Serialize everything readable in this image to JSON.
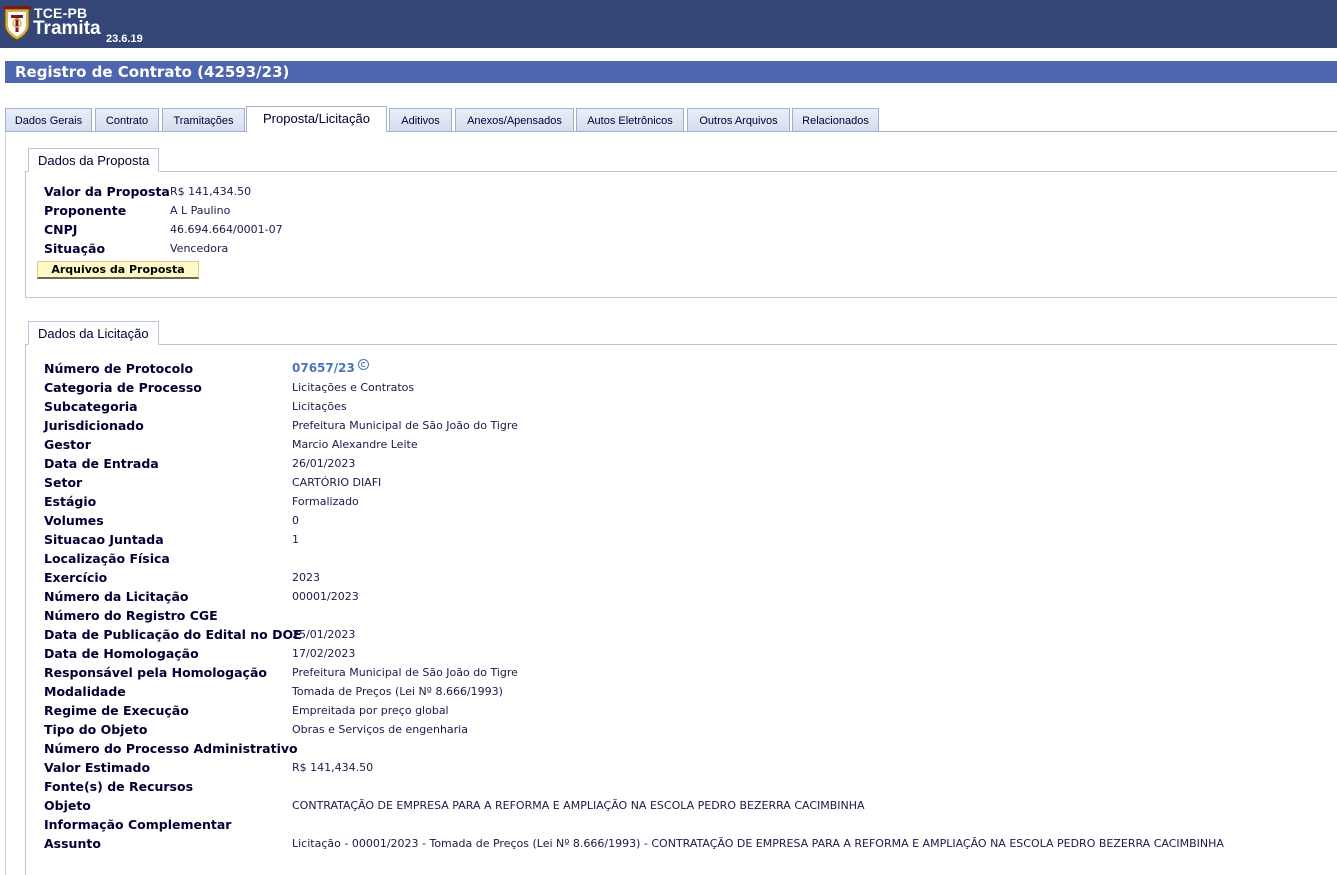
{
  "app": {
    "org": "TCE-PB",
    "name": "Tramita",
    "version": "23.6.19"
  },
  "page": {
    "title": "Registro de Contrato (42593/23)"
  },
  "tabs": [
    {
      "label": "Dados Gerais"
    },
    {
      "label": "Contrato"
    },
    {
      "label": "Tramitações"
    },
    {
      "label": "Proposta/Licitação"
    },
    {
      "label": "Aditivos"
    },
    {
      "label": "Anexos/Apensados"
    },
    {
      "label": "Autos Eletrônicos"
    },
    {
      "label": "Outros Arquivos"
    },
    {
      "label": "Relacionados"
    }
  ],
  "proposta": {
    "heading": "Dados da Proposta",
    "rows": [
      {
        "label": "Valor da Proposta",
        "value": "R$ 141,434.50"
      },
      {
        "label": "Proponente",
        "value": "A L Paulino"
      },
      {
        "label": "CNPJ",
        "value": "46.694.664/0001-07"
      },
      {
        "label": "Situação",
        "value": "Vencedora"
      }
    ],
    "files_button": "Arquivos da Proposta"
  },
  "licitacao": {
    "heading": "Dados da Licitação",
    "rows": [
      {
        "label": "Número de Protocolo",
        "value": "07657/23"
      },
      {
        "label": "Categoria de Processo",
        "value": "Licitações e Contratos"
      },
      {
        "label": "Subcategoria",
        "value": "Licitações"
      },
      {
        "label": "Jurisdicionado",
        "value": "Prefeitura Municipal de São João do Tigre"
      },
      {
        "label": "Gestor",
        "value": "Marcio Alexandre Leite"
      },
      {
        "label": "Data de Entrada",
        "value": "26/01/2023"
      },
      {
        "label": "Setor",
        "value": "CARTÓRIO DIAFI"
      },
      {
        "label": "Estágio",
        "value": "Formalizado"
      },
      {
        "label": "Volumes",
        "value": "0"
      },
      {
        "label": "Situacao Juntada",
        "value": "1"
      },
      {
        "label": "Localização Física",
        "value": ""
      },
      {
        "label": "Exercício",
        "value": "2023"
      },
      {
        "label": "Número da Licitação",
        "value": "00001/2023"
      },
      {
        "label": "Número do Registro CGE",
        "value": ""
      },
      {
        "label": "Data de Publicação do Edital no DOE",
        "value": "25/01/2023"
      },
      {
        "label": "Data de Homologação",
        "value": "17/02/2023"
      },
      {
        "label": "Responsável pela Homologação",
        "value": "Prefeitura Municipal de São João do Tigre"
      },
      {
        "label": "Modalidade",
        "value": "Tomada de Preços (Lei Nº 8.666/1993)"
      },
      {
        "label": "Regime de Execução",
        "value": "Empreitada por preço global"
      },
      {
        "label": "Tipo do Objeto",
        "value": "Obras e Serviços de engenharia"
      },
      {
        "label": "Número do Processo Administrativo",
        "value": ""
      },
      {
        "label": "Valor Estimado",
        "value": "R$ 141,434.50"
      },
      {
        "label": "Fonte(s) de Recursos",
        "value": ""
      },
      {
        "label": "Objeto",
        "value": "CONTRATAÇÃO DE EMPRESA PARA A REFORMA E AMPLIAÇÃO NA ESCOLA PEDRO BEZERRA CACIMBINHA"
      },
      {
        "label": "Informação Complementar",
        "value": ""
      },
      {
        "label": "Assunto",
        "value": "Licitação - 00001/2023 - Tomada de Preços (Lei Nº 8.666/1993) - CONTRATAÇÃO DE EMPRESA PARA A REFORMA E AMPLIAÇÃO NA ESCOLA PEDRO BEZERRA CACIMBINHA"
      }
    ]
  }
}
